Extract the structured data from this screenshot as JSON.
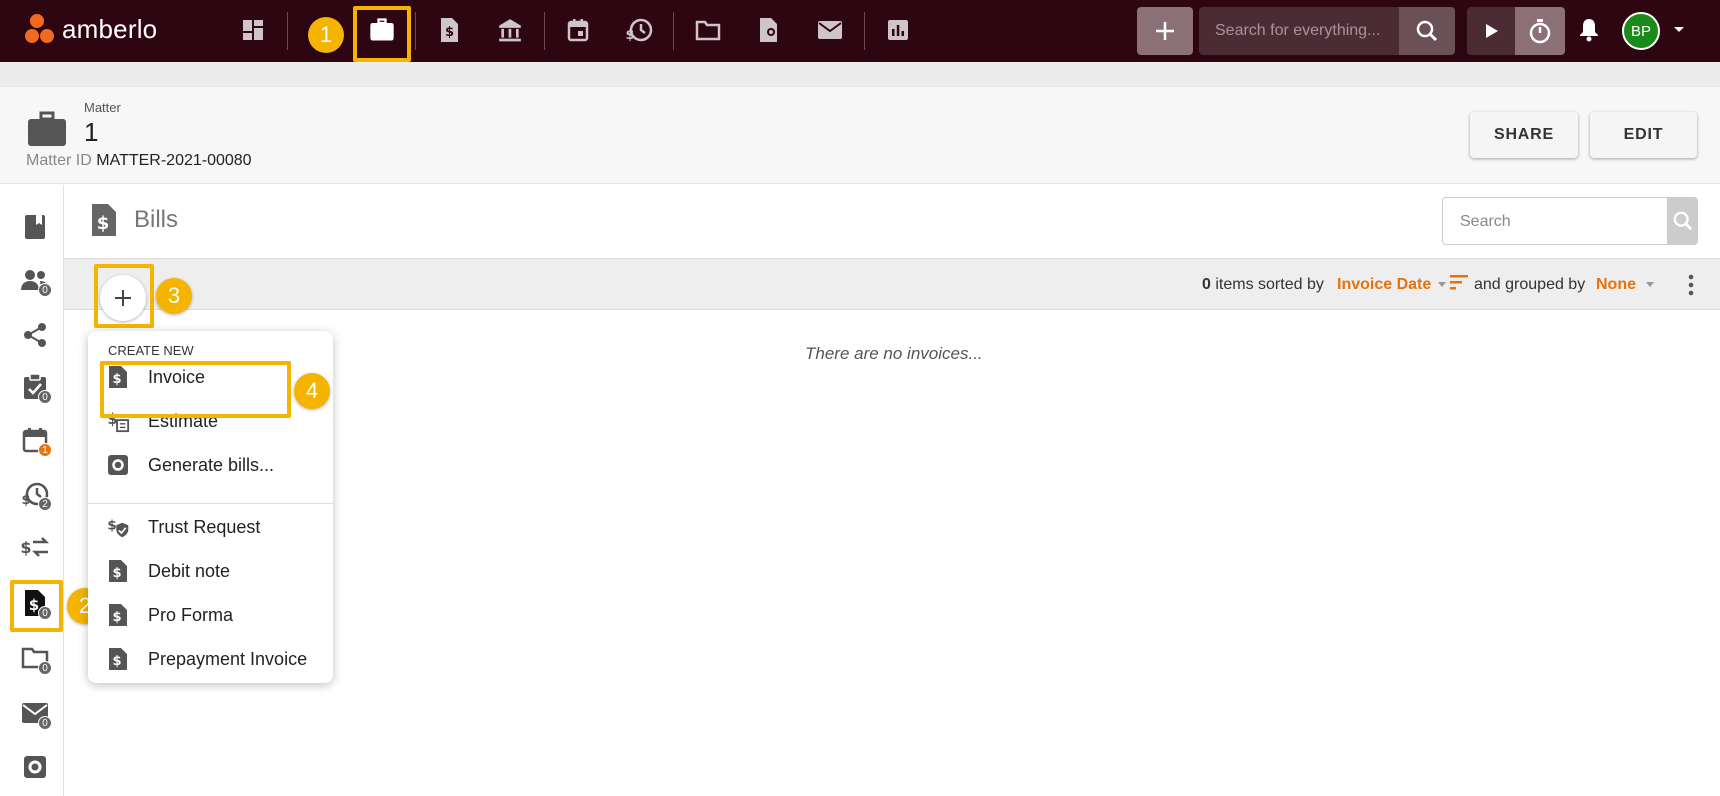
{
  "app": {
    "name": "amberlo"
  },
  "topbar": {
    "search_placeholder": "Search for everything...",
    "avatar_initials": "BP",
    "nav_icons": [
      "dashboard-icon",
      "briefcase-icon",
      "bill-icon",
      "bank-icon",
      "calendar-icon",
      "time-money-icon",
      "folder-icon",
      "certificate-icon",
      "mail-icon",
      "report-icon"
    ]
  },
  "matter": {
    "label": "Matter",
    "title": "1",
    "id_label": "Matter ID",
    "id_value": "MATTER-2021-00080",
    "share_label": "SHARE",
    "edit_label": "EDIT"
  },
  "sidebar": {
    "items": [
      {
        "name": "notebook",
        "badge": ""
      },
      {
        "name": "contacts",
        "badge": "0"
      },
      {
        "name": "share",
        "badge": ""
      },
      {
        "name": "tasks",
        "badge": "0"
      },
      {
        "name": "calendar",
        "badge": "1"
      },
      {
        "name": "time-entries",
        "badge": "2"
      },
      {
        "name": "transactions",
        "badge": ""
      },
      {
        "name": "bills",
        "badge": "0"
      },
      {
        "name": "documents",
        "badge": "0"
      },
      {
        "name": "mail",
        "badge": "0"
      },
      {
        "name": "settings",
        "badge": ""
      }
    ]
  },
  "bills": {
    "title": "Bills",
    "search_placeholder": "Search",
    "count": "0",
    "sorted_by_text": "items sorted by",
    "sort_field": "Invoice Date",
    "grouped_by_text": "and grouped by",
    "group_field": "None",
    "empty_message": "There are no invoices..."
  },
  "menu": {
    "header": "CREATE NEW",
    "items": [
      {
        "label": "Invoice"
      },
      {
        "label": "Estimate"
      },
      {
        "label": "Generate bills..."
      },
      {
        "label": "Trust Request"
      },
      {
        "label": "Debit note"
      },
      {
        "label": "Pro Forma"
      },
      {
        "label": "Prepayment Invoice"
      }
    ]
  },
  "steps": [
    "1",
    "2",
    "3",
    "4"
  ],
  "colors": {
    "topbar": "#2d0611",
    "accent": "#f5b400",
    "link": "#e8720c",
    "avatar": "#1a8a1a"
  }
}
